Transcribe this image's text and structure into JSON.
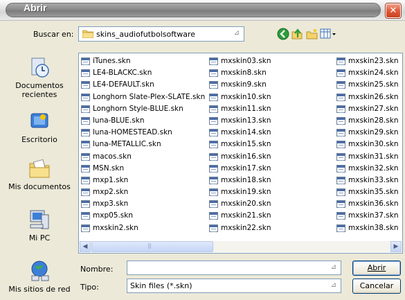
{
  "window": {
    "title": "Abrir"
  },
  "lookin": {
    "label": "Buscar en:",
    "folder": "skins_audiofutbolsoftware"
  },
  "places": [
    {
      "label": "Documentos recientes",
      "icon": "recent-documents-icon"
    },
    {
      "label": "Escritorio",
      "icon": "desktop-icon"
    },
    {
      "label": "Mis documentos",
      "icon": "my-documents-icon"
    },
    {
      "label": "Mi PC",
      "icon": "my-computer-icon"
    },
    {
      "label": "Mis sitios de red",
      "icon": "network-places-icon"
    }
  ],
  "files": {
    "col1": [
      "iTunes.skn",
      "LE4-BLACKC.skn",
      "LE4-DEFAULT.skn",
      "Longhorn Slate-Plex-SLATE.skn",
      "Longhorn Style-BLUE.skn",
      "luna-BLUE.skn",
      "luna-HOMESTEAD.skn",
      "luna-METALLIC.skn",
      "macos.skn",
      "MSN.skn",
      "mxp1.skn",
      "mxp2.skn",
      "mxp3.skn",
      "mxp05.skn",
      "mxskin2.skn"
    ],
    "col2": [
      "mxskin03.skn",
      "mxskin8.skn",
      "mxskin9.skn",
      "mxskin10.skn",
      "mxskin11.skn",
      "mxskin13.skn",
      "mxskin14.skn",
      "mxskin15.skn",
      "mxskin16.skn",
      "mxskin17.skn",
      "mxskin18.skn",
      "mxskin19.skn",
      "mxskin20.skn",
      "mxskin21.skn",
      "mxskin22.skn"
    ],
    "col3": [
      "mxskin23.skn",
      "mxskin24.skn",
      "mxskin25.skn",
      "mxskin26.skn",
      "mxskin27.skn",
      "mxskin28.skn",
      "mxskin29.skn",
      "mxskin30.skn",
      "mxskin31.skn",
      "mxskin32.skn",
      "mxskin33.skn",
      "mxskin35.skn",
      "mxskin36.skn",
      "mxskin37.skn",
      "mxskin38.skn"
    ]
  },
  "filename": {
    "label": "Nombre:",
    "value": ""
  },
  "filetype": {
    "label": "Tipo:",
    "value": "Skin files (*.skn)"
  },
  "buttons": {
    "open": "Abrir",
    "cancel": "Cancelar"
  },
  "colors": {
    "close": "#e05a3a",
    "title_pill": "#8b8b8b",
    "dialog_bg": "#ece9d8",
    "border": "#7f9db9"
  }
}
